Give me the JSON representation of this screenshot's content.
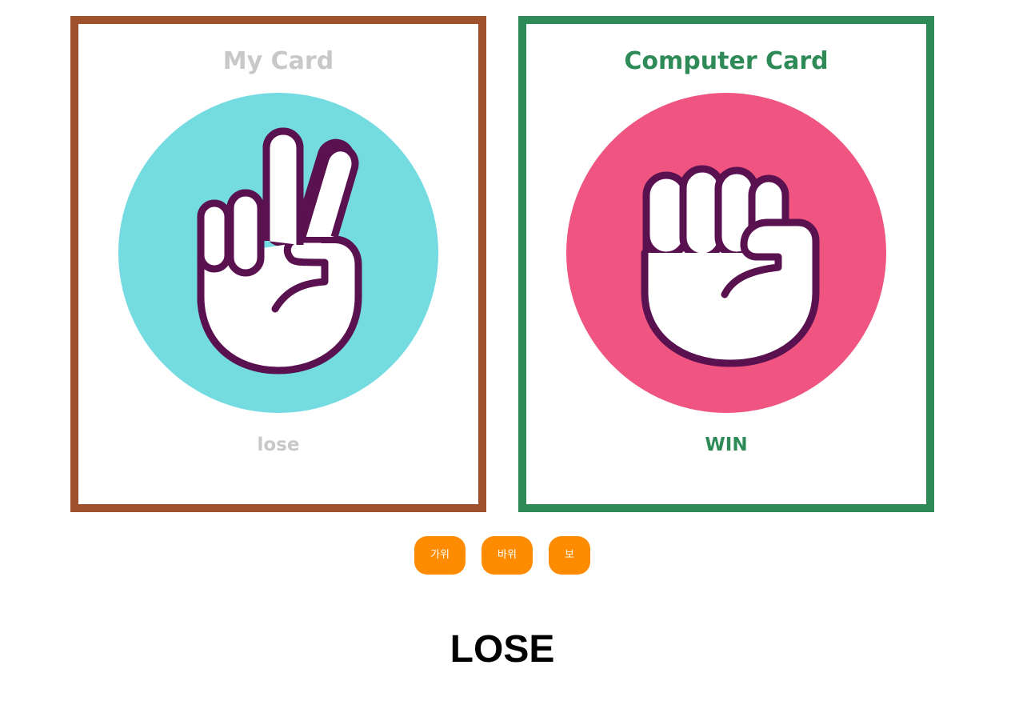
{
  "colors": {
    "my_card_border": "#a0522d",
    "computer_card_border": "#2e8b57",
    "lose_text": "#c8c8c8",
    "win_text": "#2e8b57",
    "button_bg": "#ff8c00",
    "scissors_circle": "#74dbe1",
    "rock_circle": "#ef5580",
    "hand_outline": "#5a1150"
  },
  "my_card": {
    "title": "My Card",
    "hand_icon": "scissors-hand-icon",
    "result": "lose"
  },
  "computer_card": {
    "title": "Computer Card",
    "hand_icon": "rock-fist-icon",
    "result": "WIN"
  },
  "buttons": {
    "scissors": "가위",
    "rock": "바위",
    "paper": "보"
  },
  "overall_result": "LOSE"
}
